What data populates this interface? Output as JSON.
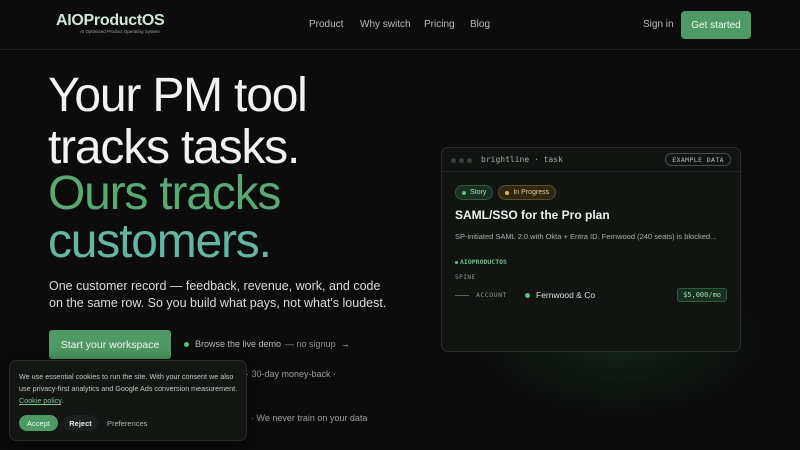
{
  "nav": {
    "logo_main": "AIOProductOS",
    "logo_sub": "AI Optimized Product Operating System",
    "links": [
      "Product",
      "Why switch",
      "Pricing",
      "Blog"
    ],
    "signin": "Sign in",
    "cta": "Get started"
  },
  "hero": {
    "line1": "Your PM tool",
    "line2": "tracks tasks.",
    "line3": "Ours tracks",
    "line4": "customers.",
    "subtitle": "One customer record — feedback, revenue, work, and code on the same row. So you build what pays, not what's loudest.",
    "cta": "Start your workspace",
    "demo_label": "Browse the live demo",
    "demo_suffix": "— no signup",
    "demo_arrow": "→",
    "trust1": "·  30-day money-back  ·",
    "trust2": "·  We never train on your data"
  },
  "card": {
    "path": "brightline · task",
    "example_badge": "EXAMPLE DATA",
    "badge_story": "Story",
    "badge_status": "In Progress",
    "title": "SAML/SSO for the Pro plan",
    "description": "SP-initiated SAML 2.0 with Okta + Entra ID. Fernwood (240 seats) is blocked...",
    "brand": "AIOPRODUCTOS",
    "spine_label": "SPINE",
    "account_label": "ACCOUNT",
    "account_name": "Fernwood & Co",
    "amount": "$5,000/mo"
  },
  "cookie": {
    "text": "We use essential cookies to run the site. With your consent we also use privacy-first analytics and Google Ads conversion measurement.",
    "link": "Cookie policy",
    "accept": "Accept",
    "reject": "Reject",
    "preferences": "Preferences"
  },
  "colors": {
    "accent": "#4f9a64",
    "headline_green": "#5aa873",
    "headline_teal": "#67b4a5",
    "background": "#0b0c0b"
  }
}
